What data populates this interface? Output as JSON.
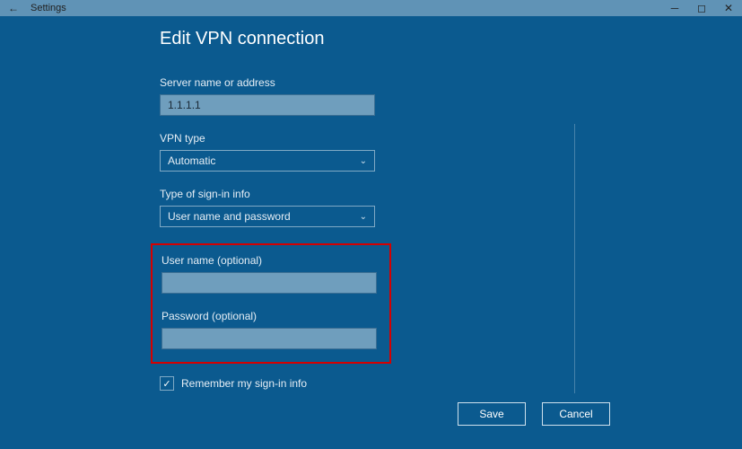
{
  "window": {
    "title": "Settings"
  },
  "page": {
    "title": "Edit VPN connection"
  },
  "fields": {
    "server": {
      "label": "Server name or address",
      "value": "1.1.1.1"
    },
    "vpntype": {
      "label": "VPN type",
      "value": "Automatic"
    },
    "signin": {
      "label": "Type of sign-in info",
      "value": "User name and password"
    },
    "username": {
      "label": "User name (optional)",
      "value": ""
    },
    "password": {
      "label": "Password (optional)",
      "value": ""
    }
  },
  "remember": {
    "label": "Remember my sign-in info",
    "checked": true
  },
  "buttons": {
    "save": "Save",
    "cancel": "Cancel"
  }
}
